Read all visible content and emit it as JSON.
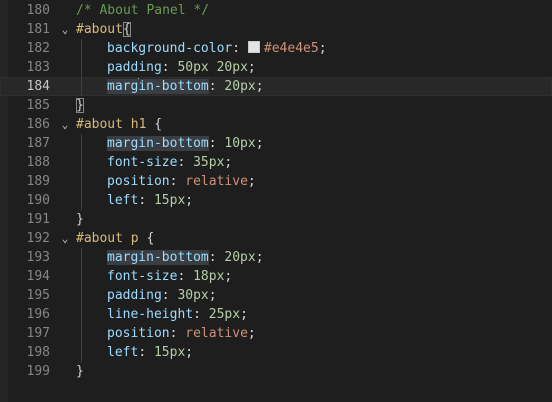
{
  "editor": {
    "language": "css",
    "current_line": 184,
    "colors": {
      "background": "#1e1e1e",
      "selector": "#d7ba7d",
      "property": "#9cdcfe",
      "number": "#b5cea8",
      "string_value": "#ce9178",
      "comment": "#6a9955"
    },
    "lines": [
      {
        "n": "180",
        "fold": "",
        "tokens": [
          {
            "t": "comment",
            "v": "/* About Panel */"
          }
        ]
      },
      {
        "n": "181",
        "fold": "⌄",
        "tokens": [
          {
            "t": "selector",
            "v": "#about"
          },
          {
            "t": "brace",
            "v": "{",
            "match": true
          }
        ]
      },
      {
        "n": "182",
        "fold": "",
        "indent": 1,
        "tokens": [
          {
            "t": "prop",
            "v": "background-color"
          },
          {
            "t": "punc",
            "v": ": "
          },
          {
            "t": "swatch",
            "v": "#e4e4e5"
          },
          {
            "t": "val",
            "v": "#e4e4e5"
          },
          {
            "t": "punc",
            "v": ";"
          }
        ]
      },
      {
        "n": "183",
        "fold": "",
        "indent": 1,
        "tokens": [
          {
            "t": "prop",
            "v": "padding"
          },
          {
            "t": "punc",
            "v": ": "
          },
          {
            "t": "num",
            "v": "50px"
          },
          {
            "t": "punc",
            "v": " "
          },
          {
            "t": "num",
            "v": "20px"
          },
          {
            "t": "punc",
            "v": ";"
          }
        ]
      },
      {
        "n": "184",
        "fold": "",
        "indent": 1,
        "tokens": [
          {
            "t": "prop",
            "v": "marg",
            "hl": true
          },
          {
            "t": "cursor",
            "v": ""
          },
          {
            "t": "prop",
            "v": "in-bottom",
            "hl": true
          },
          {
            "t": "punc",
            "v": ": "
          },
          {
            "t": "num",
            "v": "20px"
          },
          {
            "t": "punc",
            "v": ";"
          }
        ]
      },
      {
        "n": "185",
        "fold": "",
        "tokens": [
          {
            "t": "brace",
            "v": "}",
            "match": true
          }
        ]
      },
      {
        "n": "186",
        "fold": "⌄",
        "tokens": [
          {
            "t": "selector",
            "v": "#about h1"
          },
          {
            "t": "brace",
            "v": " {"
          }
        ]
      },
      {
        "n": "187",
        "fold": "",
        "indent": 1,
        "tokens": [
          {
            "t": "prop",
            "v": "margin-bottom",
            "hl": true
          },
          {
            "t": "punc",
            "v": ": "
          },
          {
            "t": "num",
            "v": "10px"
          },
          {
            "t": "punc",
            "v": ";"
          }
        ]
      },
      {
        "n": "188",
        "fold": "",
        "indent": 1,
        "tokens": [
          {
            "t": "prop",
            "v": "font-size"
          },
          {
            "t": "punc",
            "v": ": "
          },
          {
            "t": "num",
            "v": "35px"
          },
          {
            "t": "punc",
            "v": ";"
          }
        ]
      },
      {
        "n": "189",
        "fold": "",
        "indent": 1,
        "tokens": [
          {
            "t": "prop",
            "v": "position"
          },
          {
            "t": "punc",
            "v": ": "
          },
          {
            "t": "val",
            "v": "relative"
          },
          {
            "t": "punc",
            "v": ";"
          }
        ]
      },
      {
        "n": "190",
        "fold": "",
        "indent": 1,
        "tokens": [
          {
            "t": "prop",
            "v": "left"
          },
          {
            "t": "punc",
            "v": ": "
          },
          {
            "t": "num",
            "v": "15px"
          },
          {
            "t": "punc",
            "v": ";"
          }
        ]
      },
      {
        "n": "191",
        "fold": "",
        "tokens": [
          {
            "t": "brace",
            "v": "}"
          }
        ]
      },
      {
        "n": "192",
        "fold": "⌄",
        "tokens": [
          {
            "t": "selector",
            "v": "#about p"
          },
          {
            "t": "brace",
            "v": " {"
          }
        ]
      },
      {
        "n": "193",
        "fold": "",
        "indent": 1,
        "tokens": [
          {
            "t": "prop",
            "v": "margin-bottom",
            "hl": true
          },
          {
            "t": "punc",
            "v": ": "
          },
          {
            "t": "num",
            "v": "20px"
          },
          {
            "t": "punc",
            "v": ";"
          }
        ]
      },
      {
        "n": "194",
        "fold": "",
        "indent": 1,
        "tokens": [
          {
            "t": "prop",
            "v": "font-size"
          },
          {
            "t": "punc",
            "v": ": "
          },
          {
            "t": "num",
            "v": "18px"
          },
          {
            "t": "punc",
            "v": ";"
          }
        ]
      },
      {
        "n": "195",
        "fold": "",
        "indent": 1,
        "tokens": [
          {
            "t": "prop",
            "v": "padding"
          },
          {
            "t": "punc",
            "v": ": "
          },
          {
            "t": "num",
            "v": "30px"
          },
          {
            "t": "punc",
            "v": ";"
          }
        ]
      },
      {
        "n": "196",
        "fold": "",
        "indent": 1,
        "tokens": [
          {
            "t": "prop",
            "v": "line-height"
          },
          {
            "t": "punc",
            "v": ": "
          },
          {
            "t": "num",
            "v": "25px"
          },
          {
            "t": "punc",
            "v": ";"
          }
        ]
      },
      {
        "n": "197",
        "fold": "",
        "indent": 1,
        "tokens": [
          {
            "t": "prop",
            "v": "position"
          },
          {
            "t": "punc",
            "v": ": "
          },
          {
            "t": "val",
            "v": "relative"
          },
          {
            "t": "punc",
            "v": ";"
          }
        ]
      },
      {
        "n": "198",
        "fold": "",
        "indent": 1,
        "tokens": [
          {
            "t": "prop",
            "v": "left"
          },
          {
            "t": "punc",
            "v": ": "
          },
          {
            "t": "num",
            "v": "15px"
          },
          {
            "t": "punc",
            "v": ";"
          }
        ]
      },
      {
        "n": "199",
        "fold": "",
        "tokens": [
          {
            "t": "brace",
            "v": "}"
          }
        ]
      }
    ]
  }
}
